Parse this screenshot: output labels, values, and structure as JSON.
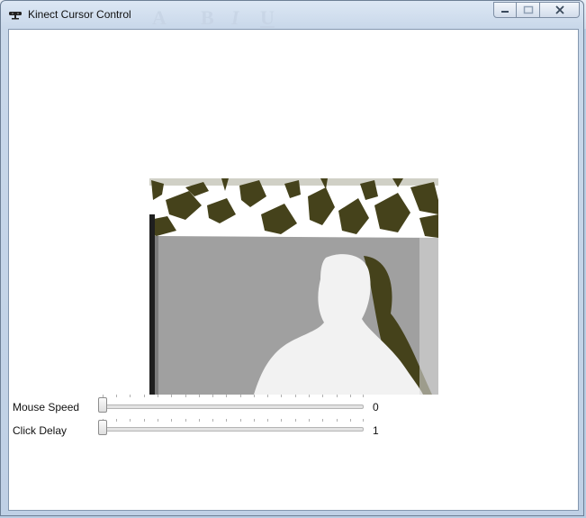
{
  "window": {
    "title": "Kinect Cursor Control",
    "icon": "kinect-sensor-icon",
    "buttons": [
      "minimize-icon",
      "maximize-icon",
      "close-icon"
    ]
  },
  "depth_image": {
    "icon": "kinect-depth-view"
  },
  "sliders": [
    {
      "label": "Mouse Speed",
      "value": "0",
      "ticks": 20,
      "position": 0
    },
    {
      "label": "Click Delay",
      "value": "1",
      "ticks": 20,
      "position": 0
    }
  ],
  "colors": {
    "shadow": "#45421b",
    "wall": "#a0a0a0",
    "person": "#f2f2f2"
  }
}
